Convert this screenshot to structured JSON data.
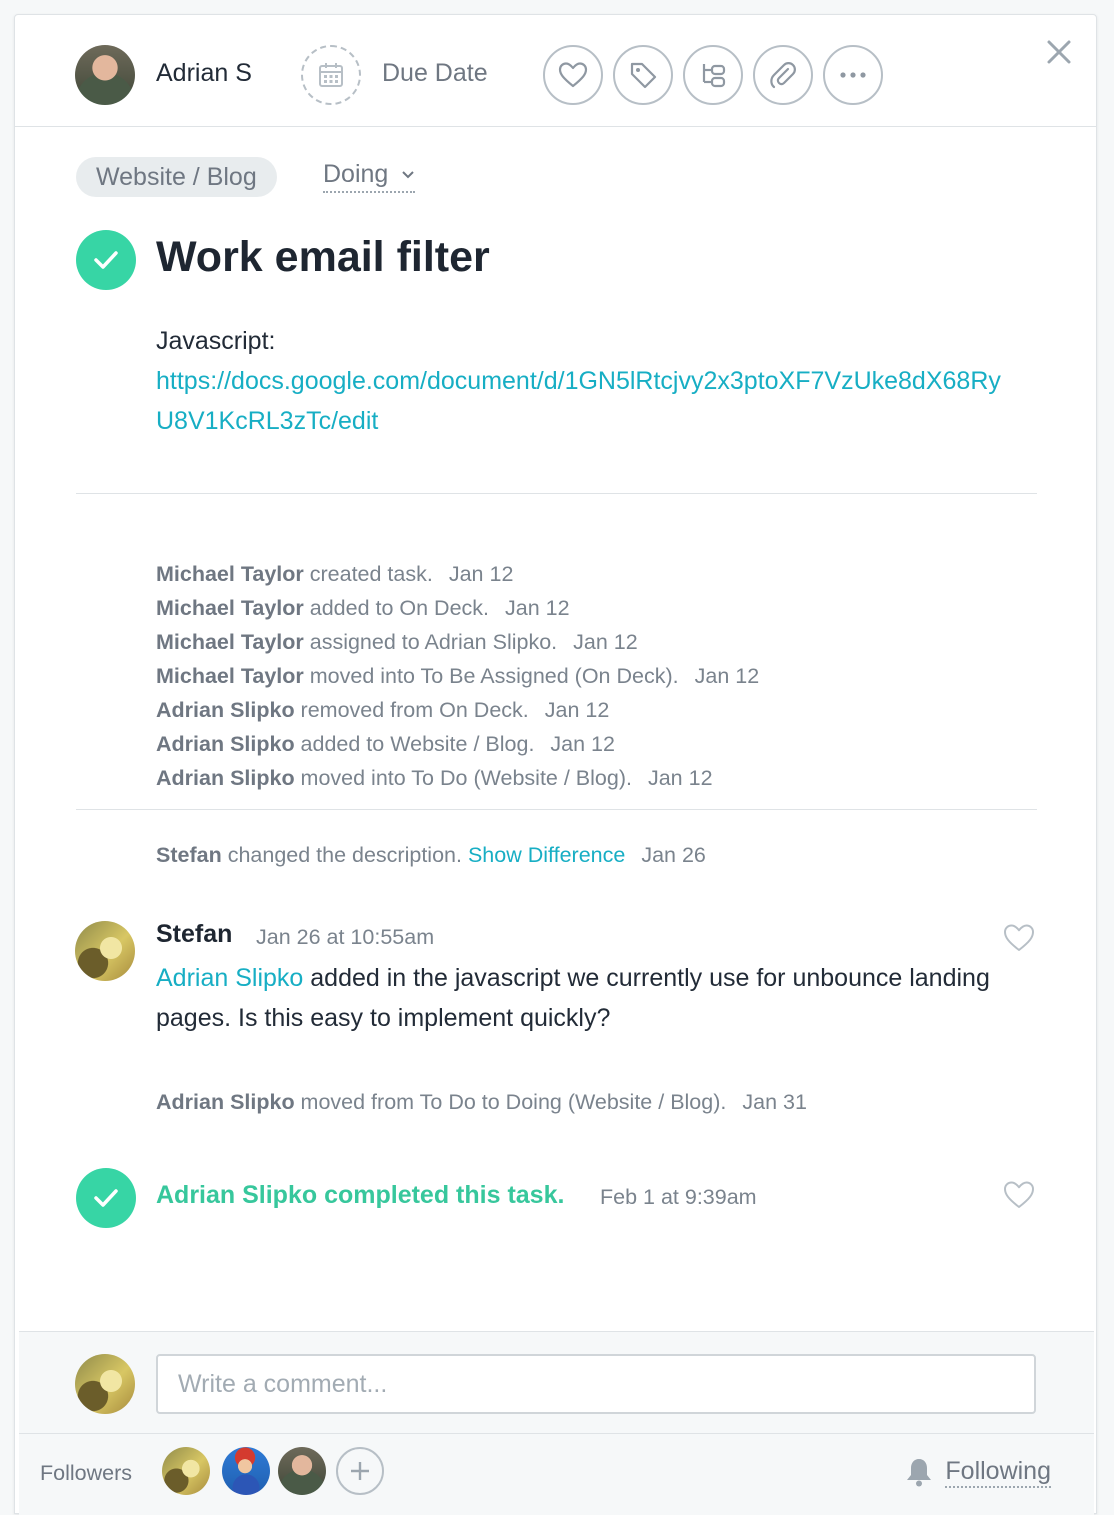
{
  "header": {
    "assignee_name": "Adrian S",
    "due_date_label": "Due Date"
  },
  "task": {
    "project": "Website / Blog",
    "section": "Doing",
    "title": "Work email filter",
    "description_label": "Javascript:",
    "description_link": "https://docs.google.com/document/d/1GN5lRtcjvy2x3ptoXF7VzUke8dX68RyU8V1KcRL3zTc/edit"
  },
  "stories": [
    {
      "actor": "Michael Taylor",
      "text": " created task.",
      "date": "Jan 12"
    },
    {
      "actor": "Michael Taylor",
      "text": " added to On Deck.",
      "date": "Jan 12"
    },
    {
      "actor": "Michael Taylor",
      "text": " assigned to Adrian Slipko.",
      "date": "Jan 12"
    },
    {
      "actor": "Michael Taylor",
      "text": " moved into To Be Assigned (On Deck).",
      "date": "Jan 12"
    },
    {
      "actor": "Adrian Slipko",
      "text": " removed from On Deck.",
      "date": "Jan 12"
    },
    {
      "actor": "Adrian Slipko",
      "text": " added to Website / Blog.",
      "date": "Jan 12"
    },
    {
      "actor": "Adrian Slipko",
      "text": " moved into To Do (Website / Blog).",
      "date": "Jan 12"
    }
  ],
  "description_change": {
    "actor": "Stefan",
    "text": " changed the description.",
    "link": "Show Difference",
    "date": "Jan 26"
  },
  "comment": {
    "author": "Stefan",
    "time": "Jan 26 at 10:55am",
    "mention": "Adrian Slipko",
    "body": " added in the javascript we currently use for unbounce landing pages. Is this easy to implement quickly?"
  },
  "move_story": {
    "actor": "Adrian Slipko",
    "text": " moved from To Do to Doing (Website / Blog).",
    "date": "Jan 31"
  },
  "completion": {
    "text": "Adrian Slipko completed this task.",
    "time": "Feb 1 at 9:39am"
  },
  "composer": {
    "placeholder": "Write a comment..."
  },
  "footer": {
    "followers_label": "Followers",
    "following_label": "Following"
  },
  "colors": {
    "accent_green": "#37d5a5",
    "link_teal": "#17aec4"
  },
  "icons": [
    "calendar-icon",
    "heart-icon",
    "tag-icon",
    "subtask-icon",
    "paperclip-icon",
    "more-icon",
    "close-icon",
    "check-icon",
    "bell-icon",
    "plus-icon",
    "chevron-down-icon"
  ]
}
